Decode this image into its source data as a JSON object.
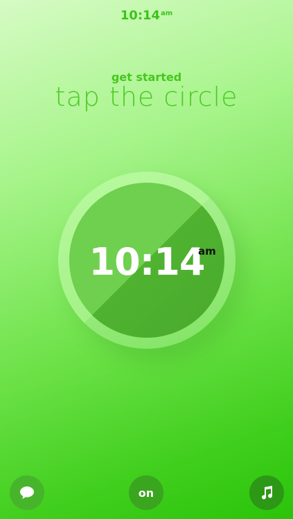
{
  "status_bar": {
    "time": "10:14",
    "ampm": "am"
  },
  "header": {
    "subtitle": "get started",
    "title": "tap the circle"
  },
  "dial": {
    "time": "10:14",
    "ampm": "am"
  },
  "bottom_bar": {
    "chat_icon": "speech-bubble-icon",
    "alarm_toggle_label": "on",
    "music_icon": "music-note-icon"
  },
  "colors": {
    "accent": "#4ccb24",
    "dial_light": "#6fcf4e",
    "dial_dark": "#4aa92c"
  }
}
